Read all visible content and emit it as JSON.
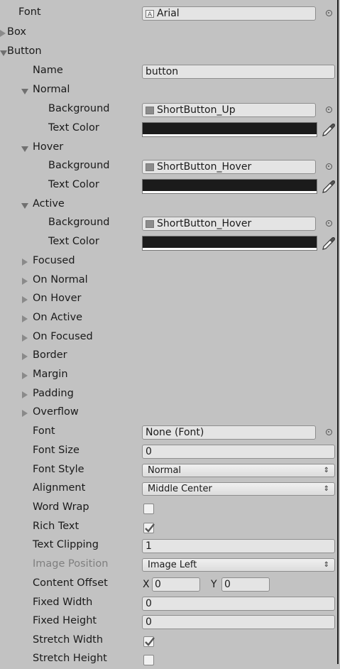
{
  "font_row": {
    "label": "Font",
    "value": "Arial",
    "icon": "font-asset-icon"
  },
  "box": {
    "label": "Box"
  },
  "button": {
    "label": "Button",
    "name_label": "Name",
    "name_value": "button",
    "states": [
      {
        "label": "Normal",
        "background_label": "Background",
        "background_value": "ShortButton_Up",
        "text_color_label": "Text Color",
        "text_color": "#1b1b1b"
      },
      {
        "label": "Hover",
        "background_label": "Background",
        "background_value": "ShortButton_Hover",
        "text_color_label": "Text Color",
        "text_color": "#1b1b1b"
      },
      {
        "label": "Active",
        "background_label": "Background",
        "background_value": "ShortButton_Hover",
        "text_color_label": "Text Color",
        "text_color": "#1b1b1b"
      }
    ],
    "collapsed": [
      "Focused",
      "On Normal",
      "On Hover",
      "On Active",
      "On Focused",
      "Border",
      "Margin",
      "Padding",
      "Overflow"
    ],
    "font_label": "Font",
    "font_value": "None (Font)",
    "font_size_label": "Font Size",
    "font_size_value": "0",
    "font_style_label": "Font Style",
    "font_style_value": "Normal",
    "alignment_label": "Alignment",
    "alignment_value": "Middle Center",
    "word_wrap_label": "Word Wrap",
    "word_wrap": false,
    "rich_text_label": "Rich Text",
    "rich_text": true,
    "text_clipping_label": "Text Clipping",
    "text_clipping_value": "1",
    "image_position_label": "Image Position",
    "image_position_value": "Image Left",
    "content_offset_label": "Content Offset",
    "offset_x_label": "X",
    "offset_x_value": "0",
    "offset_y_label": "Y",
    "offset_y_value": "0",
    "fixed_width_label": "Fixed Width",
    "fixed_width_value": "0",
    "fixed_height_label": "Fixed Height",
    "fixed_height_value": "0",
    "stretch_width_label": "Stretch Width",
    "stretch_width": true,
    "stretch_height_label": "Stretch Height",
    "stretch_height": false
  },
  "colors": {
    "background": "#c2c2c2",
    "field": "#e4e4e4",
    "text": "#1a1a1a",
    "disabled_text": "#7f7f7f"
  }
}
